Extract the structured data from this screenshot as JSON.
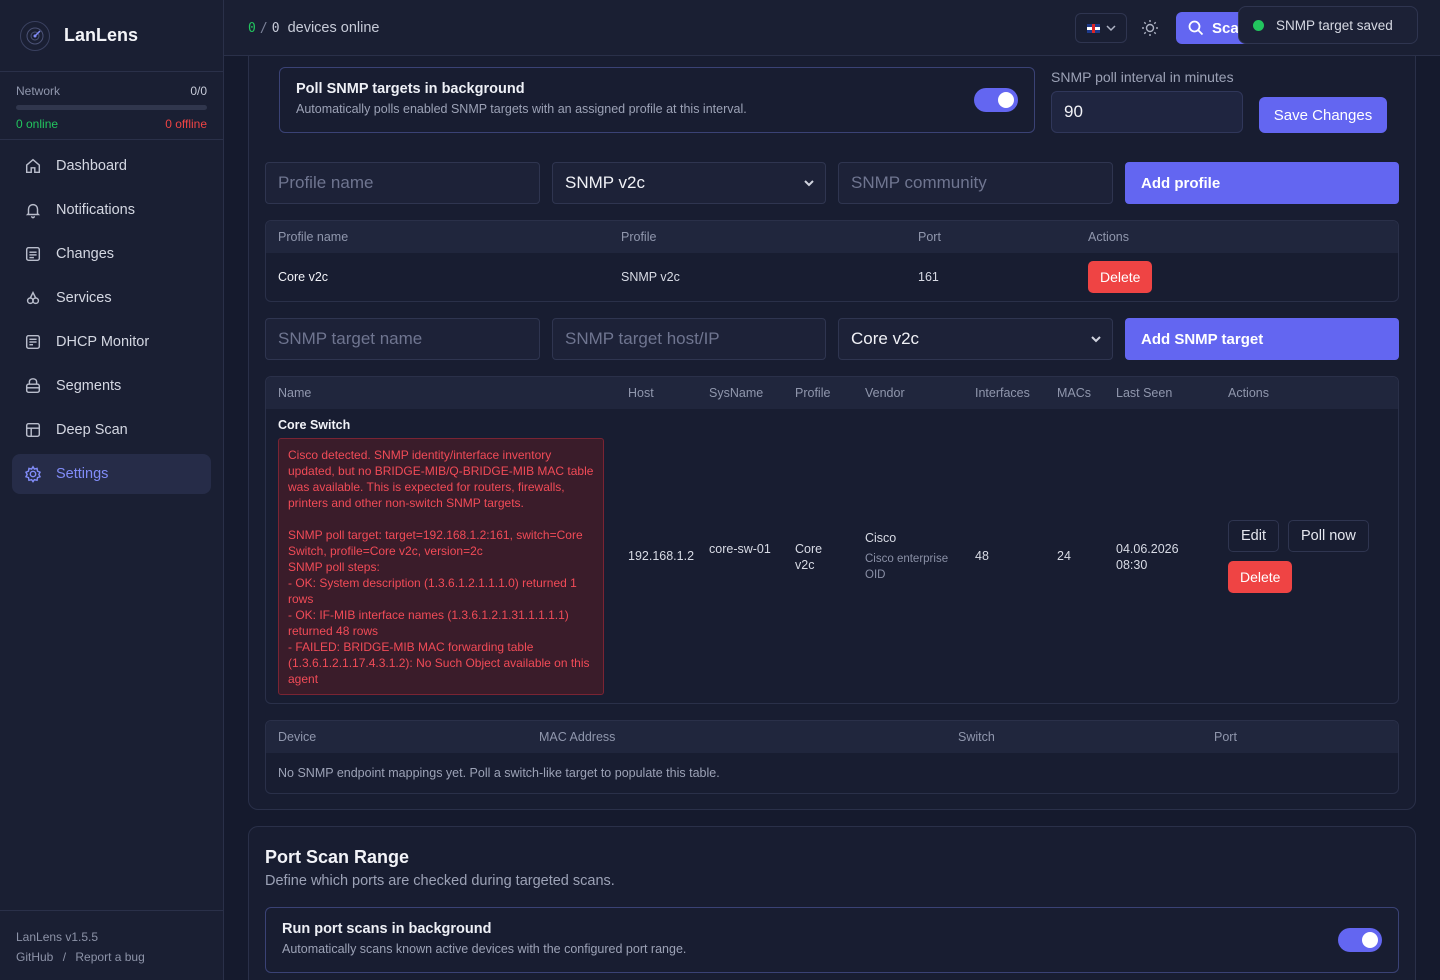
{
  "app": {
    "name": "LanLens",
    "version": "LanLens v1.5.5",
    "github": "GitHub",
    "separator": "/",
    "report_bug": "Report a bug"
  },
  "network": {
    "label": "Network",
    "count": "0/0",
    "online": "0 online",
    "offline": "0 offline"
  },
  "nav": [
    {
      "label": "Dashboard",
      "icon": "home-icon"
    },
    {
      "label": "Notifications",
      "icon": "bell-icon"
    },
    {
      "label": "Changes",
      "icon": "document-icon"
    },
    {
      "label": "Services",
      "icon": "services-icon"
    },
    {
      "label": "DHCP Monitor",
      "icon": "dhcp-icon"
    },
    {
      "label": "Segments",
      "icon": "segments-icon"
    },
    {
      "label": "Deep Scan",
      "icon": "grid-icon"
    },
    {
      "label": "Settings",
      "icon": "gear-icon",
      "active": true
    }
  ],
  "topbar": {
    "online_a": "0",
    "online_sep": "/",
    "online_b": "0",
    "online_label": "devices online",
    "scan_label": "Sca"
  },
  "toast": {
    "message": "SNMP target saved"
  },
  "snmp": {
    "poll_title": "Poll SNMP targets in background",
    "poll_desc": "Automatically polls enabled SNMP targets with an assigned profile at this interval.",
    "poll_enabled": true,
    "interval_label": "SNMP poll interval in minutes",
    "interval_value": "90",
    "save_label": "Save Changes",
    "profile_form": {
      "name_placeholder": "Profile name",
      "version_value": "SNMP v2c",
      "community_placeholder": "SNMP community",
      "add_label": "Add profile"
    },
    "profiles_table": {
      "headers": [
        "Profile name",
        "Profile",
        "Port",
        "Actions"
      ],
      "rows": [
        {
          "name": "Core v2c",
          "profile": "SNMP v2c",
          "port": "161",
          "delete": "Delete"
        }
      ]
    },
    "target_form": {
      "name_placeholder": "SNMP target name",
      "host_placeholder": "SNMP target host/IP",
      "profile_value": "Core v2c",
      "add_label": "Add SNMP target"
    },
    "targets_table": {
      "headers": [
        "Name",
        "Host",
        "SysName",
        "Profile",
        "Vendor",
        "Interfaces",
        "MACs",
        "Last Seen",
        "Actions"
      ],
      "row": {
        "name": "Core Switch",
        "error_lines": [
          "Cisco detected. SNMP identity/interface inventory updated, but no BRIDGE-MIB/Q-BRIDGE-MIB MAC table was available. This is expected for routers, firewalls, printers and other non-switch SNMP targets.",
          "",
          "SNMP poll target: target=192.168.1.2:161, switch=Core Switch, profile=Core v2c, version=2c",
          "SNMP poll steps:",
          "- OK: System description (1.3.6.1.2.1.1.1.0) returned 1 rows",
          "- OK: IF-MIB interface names (1.3.6.1.2.1.31.1.1.1.1) returned 48 rows",
          "- FAILED: BRIDGE-MIB MAC forwarding table (1.3.6.1.2.1.17.4.3.1.2): No Such Object available on this agent"
        ],
        "host": "192.168.1.2",
        "sysname": "core-sw-01",
        "profile": "Core v2c",
        "vendor": "Cisco",
        "vendor_detail": "Cisco enterprise OID",
        "interfaces": "48",
        "macs": "24",
        "last_seen": "04.06.2026 08:30",
        "edit": "Edit",
        "poll_now": "Poll now",
        "delete": "Delete"
      }
    },
    "mappings_table": {
      "headers": [
        "Device",
        "MAC Address",
        "Switch",
        "Port"
      ],
      "empty": "No SNMP endpoint mappings yet. Poll a switch-like target to populate this table."
    }
  },
  "port_scan": {
    "title": "Port Scan Range",
    "desc": "Define which ports are checked during targeted scans.",
    "run_title": "Run port scans in background",
    "run_desc": "Automatically scans known active devices with the configured port range.",
    "run_enabled": true
  },
  "colors": {
    "accent": "#6366f1",
    "danger": "#ef4444",
    "success": "#22c55e"
  }
}
